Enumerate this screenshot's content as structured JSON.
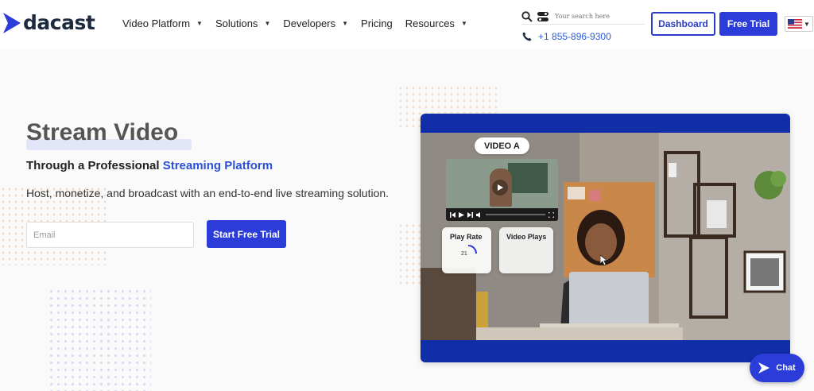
{
  "brand": {
    "name": "dacast"
  },
  "nav": {
    "items": [
      {
        "label": "Video Platform",
        "has_menu": true
      },
      {
        "label": "Solutions",
        "has_menu": true
      },
      {
        "label": "Developers",
        "has_menu": true
      },
      {
        "label": "Pricing",
        "has_menu": false
      },
      {
        "label": "Resources",
        "has_menu": true
      }
    ]
  },
  "search": {
    "placeholder": "Your search here"
  },
  "contact": {
    "phone": "+1 855-896-9300"
  },
  "header_buttons": {
    "dashboard": "Dashboard",
    "free_trial": "Free Trial"
  },
  "language": {
    "selected": "US flag"
  },
  "hero": {
    "title": "Stream Video",
    "subtitle_prefix": "Through a Professional ",
    "subtitle_accent": "Streaming Platform",
    "description": "Host, monetize, and broadcast with an end-to-end live streaming solution.",
    "email_placeholder": "Email",
    "cta": "Start Free Trial"
  },
  "video": {
    "tag": "VIDEO A",
    "stat_1_label": "Play Rate",
    "stat_1_value": "21",
    "stat_2_label": "Video Plays"
  },
  "chat": {
    "label": "Chat"
  },
  "colors": {
    "primary": "#2b3cd8",
    "accent_text": "#2b50d8",
    "video_frame": "#0f2ea8"
  }
}
